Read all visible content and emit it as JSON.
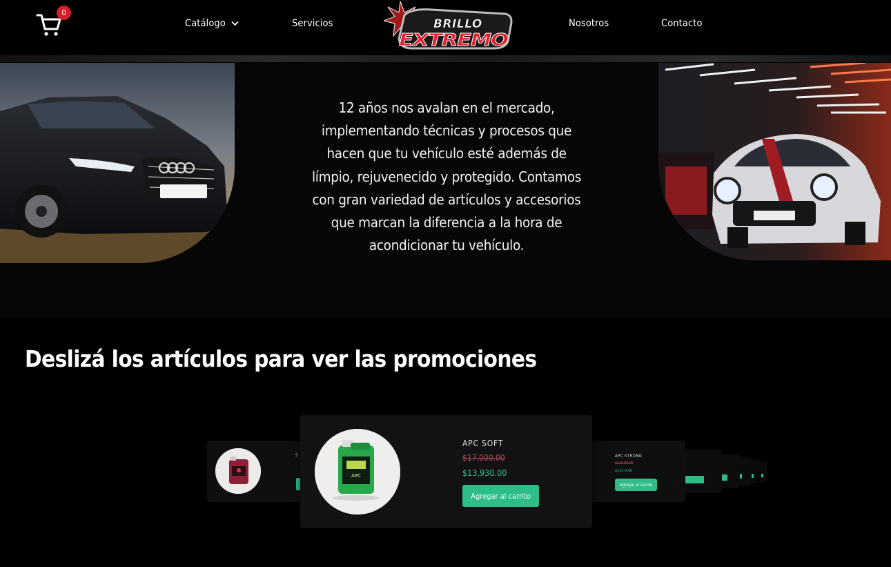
{
  "header": {
    "cart_count": "0",
    "nav": {
      "catalogo": "Catálogo",
      "servicios": "Servicios",
      "nosotros": "Nosotros",
      "contacto": "Contacto"
    },
    "logo_text_top": "BRILLO",
    "logo_text_bottom": "EXTREMO"
  },
  "hero": {
    "text": "12 años nos avalan en el mercado, implementando técnicas y procesos que hacen que tu vehículo esté además de límpio, rejuvenecido y protegido. Contamos con gran variedad de artículos y accesorios que marcan la diferencia a la hora de acondicionar tu vehículo."
  },
  "promo": {
    "title": "Deslizá los artículos para ver las promociones",
    "main_product": {
      "name": "APC SOFT",
      "old_price": "$17,000.00",
      "new_price": "$13,930.00",
      "button": "Agregar al carrito"
    },
    "right_product": {
      "name": "APC STRONG",
      "old_price": "$1,8 00.00",
      "new_price": "$125 0.00",
      "button": "Agregar al carrito"
    },
    "left_product": {
      "name": "S"
    }
  },
  "colors": {
    "accent_green": "#2ebd86",
    "badge_red": "#d61f2b",
    "old_price_red": "#b24a55"
  }
}
